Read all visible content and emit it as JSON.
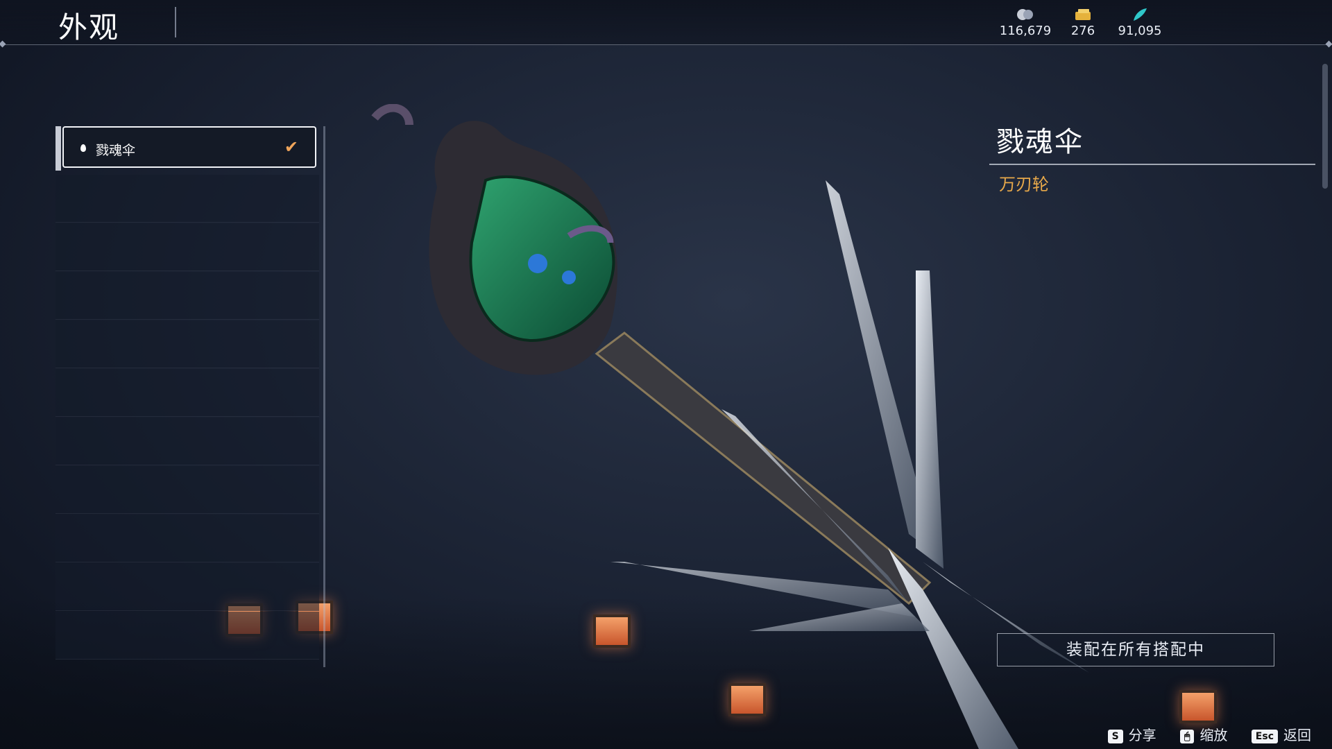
{
  "header": {
    "title": "外观"
  },
  "currencies": [
    {
      "icon": "coin-icon",
      "value": "116,679",
      "color": "#c9ced8"
    },
    {
      "icon": "gold-ticket-icon",
      "value": "276",
      "color": "#e5b23c"
    },
    {
      "icon": "cyan-feather-icon",
      "value": "91,095",
      "color": "#2fc7c9"
    }
  ],
  "list": {
    "selected_item": {
      "label": "戮魂伞",
      "equipped": true
    }
  },
  "detail": {
    "name": "戮魂伞",
    "type": "万刃轮"
  },
  "actions": {
    "equip_all_label": "装配在所有搭配中"
  },
  "hints": [
    {
      "key": "S",
      "label": "分享"
    },
    {
      "key": "🖱",
      "label": "缩放"
    },
    {
      "key": "Esc",
      "label": "返回"
    }
  ],
  "colors": {
    "accent": "#e7a84a",
    "check": "#f0a55a"
  }
}
